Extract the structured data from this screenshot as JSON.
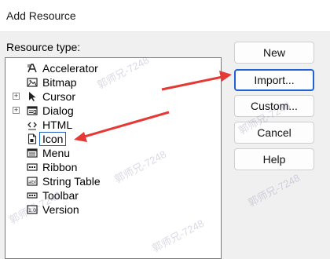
{
  "window": {
    "title": "Add Resource"
  },
  "tree": {
    "label": "Resource type:",
    "items": [
      {
        "label": "Accelerator",
        "icon": "accelerator-icon",
        "expandable": false
      },
      {
        "label": "Bitmap",
        "icon": "bitmap-icon",
        "expandable": false
      },
      {
        "label": "Cursor",
        "icon": "cursor-icon",
        "expandable": true
      },
      {
        "label": "Dialog",
        "icon": "dialog-icon",
        "expandable": true
      },
      {
        "label": "HTML",
        "icon": "html-icon",
        "expandable": false
      },
      {
        "label": "Icon",
        "icon": "icon-resource-icon",
        "expandable": false,
        "selected": true
      },
      {
        "label": "Menu",
        "icon": "menu-icon",
        "expandable": false
      },
      {
        "label": "Ribbon",
        "icon": "ribbon-icon",
        "expandable": false
      },
      {
        "label": "String Table",
        "icon": "string-table-icon",
        "expandable": false
      },
      {
        "label": "Toolbar",
        "icon": "toolbar-icon",
        "expandable": false
      },
      {
        "label": "Version",
        "icon": "version-icon",
        "expandable": false
      }
    ]
  },
  "buttons": {
    "new": "New",
    "import": "Import...",
    "custom": "Custom...",
    "cancel": "Cancel",
    "help": "Help"
  },
  "watermark_text": "郭师兄-7248",
  "colors": {
    "arrow": "#e53935",
    "focus_border": "#1e63d6",
    "selection_border": "#1f5fbf"
  }
}
